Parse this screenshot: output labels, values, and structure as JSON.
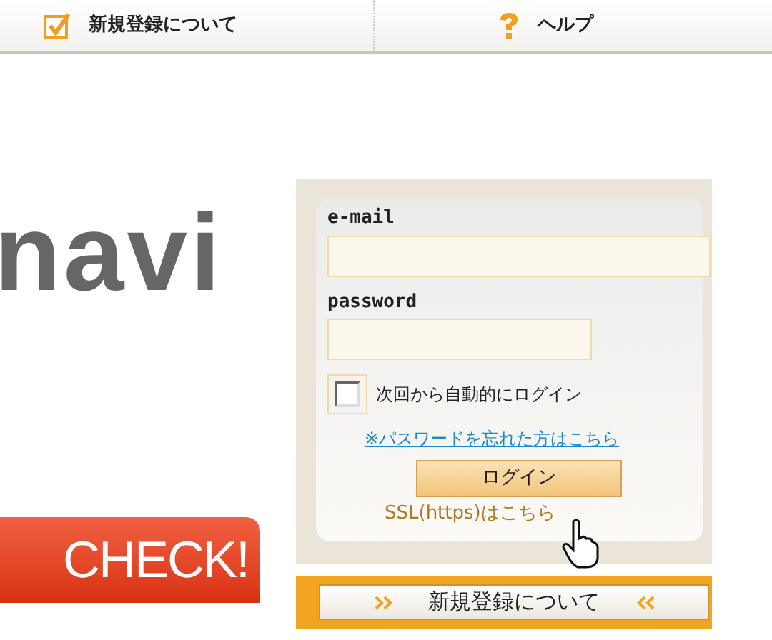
{
  "nav": {
    "items": [
      {
        "kind": "check",
        "label": "新規登録について"
      },
      {
        "kind": "help",
        "label": "ヘルプ"
      }
    ]
  },
  "logo": {
    "text": "navi"
  },
  "check_banner": {
    "label": "CHECK!"
  },
  "login": {
    "email_label": "e-mail",
    "password_label": "password",
    "remember": {
      "label": "次回から自動的にログイン",
      "checked": false
    },
    "forgot_link": "※パスワードを忘れた方はこちら",
    "login_button": "ログイン",
    "ssl_link": "SSL(https)はこちら"
  },
  "register_button": {
    "label": "新規登録について"
  }
}
